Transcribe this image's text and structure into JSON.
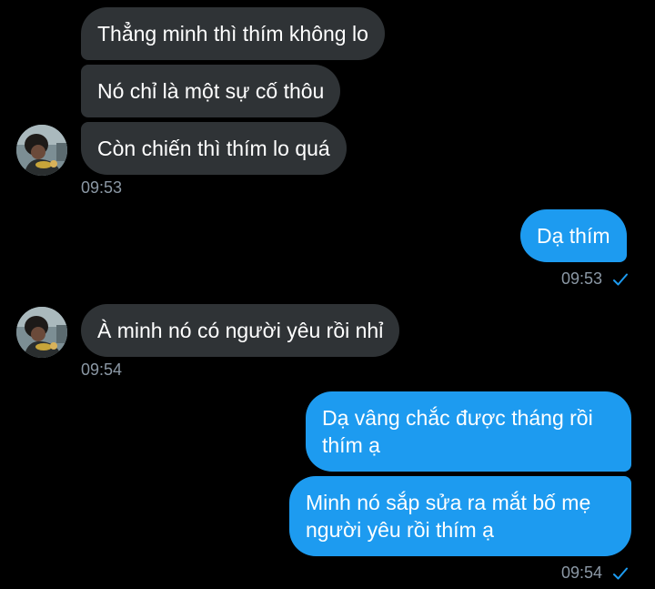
{
  "messages": {
    "m1": "Thẳng minh thì thím không lo",
    "m2": "Nó chỉ là một sự cố thôu",
    "m3": "Còn chiến thì thím lo quá",
    "t1": "09:53",
    "m4": "Dạ thím",
    "t2": "09:53",
    "m5": "À minh nó có người yêu rồi nhỉ",
    "t3": "09:54",
    "m6": "Dạ vâng chắc được tháng rồi thím ạ",
    "m7": "Minh nó sắp sửa ra mắt bố mẹ người yêu rồi thím ạ",
    "t4": "09:54"
  },
  "icons": {
    "read_receipt": "check-icon",
    "avatar": "contact-avatar"
  },
  "colors": {
    "background": "#000000",
    "incoming_bubble": "#2f3336",
    "outgoing_bubble": "#1d9bf0",
    "timestamp": "#8b98a5"
  }
}
